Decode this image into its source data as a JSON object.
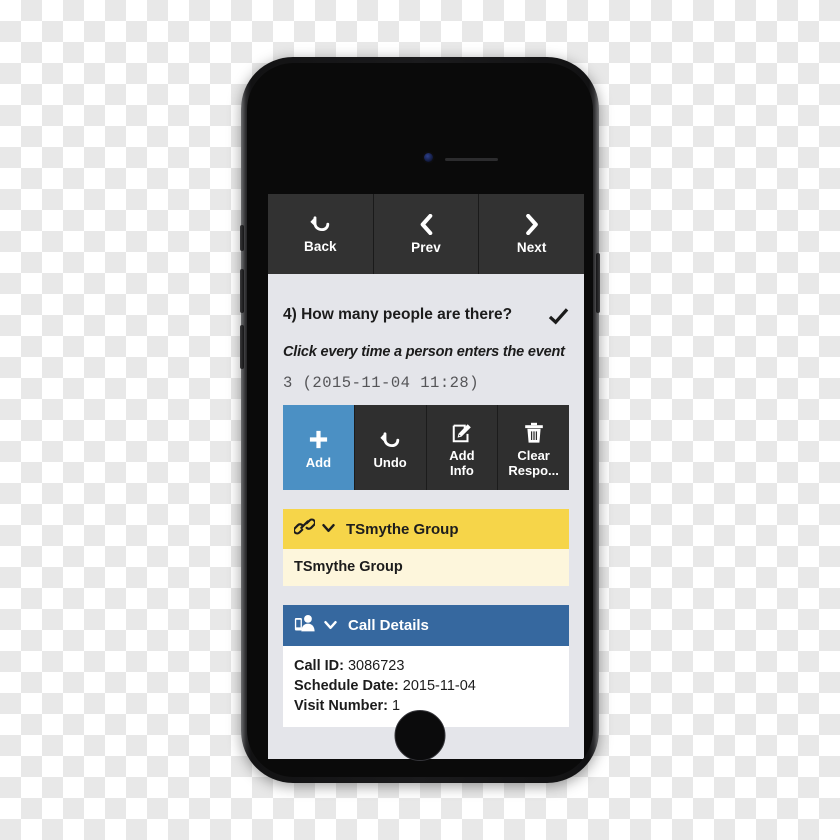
{
  "device": {
    "type": "smartphone",
    "camera": "front-camera",
    "speaker": "earpiece-speaker",
    "home_button": "home-button"
  },
  "navbar": {
    "buttons": [
      {
        "label": "Back",
        "icon": "undo-arrow-icon"
      },
      {
        "label": "Prev",
        "icon": "chevron-left-icon"
      },
      {
        "label": "Next",
        "icon": "chevron-right-icon"
      }
    ]
  },
  "question": {
    "text": "4) How many people are there?",
    "check_icon": "checkmark-icon",
    "hint": "Click every time a person enters the event",
    "response_value": "3 (2015-11-04 11:28)"
  },
  "actions": [
    {
      "label": "Add",
      "icon": "plus-icon",
      "style": "primary"
    },
    {
      "label": "Undo",
      "icon": "undo-arrow-icon",
      "style": "default"
    },
    {
      "label": "Add\nInfo",
      "line1": "Add",
      "line2": "Info",
      "icon": "note-pencil-icon",
      "style": "default"
    },
    {
      "label": "Clear\nRespo...",
      "line1": "Clear",
      "line2": "Respo...",
      "icon": "trash-icon",
      "style": "default"
    }
  ],
  "panels": [
    {
      "id": "tsmythe-group",
      "title": "TSmythe Group",
      "icon": "link-chain-icon",
      "chevron": "chevron-down-icon",
      "header_color": "#f6d549",
      "body_color": "#fdf6dc",
      "body_text": "TSmythe Group"
    },
    {
      "id": "call-details",
      "title": "Call Details",
      "icon": "phone-contact-icon",
      "chevron": "chevron-down-icon",
      "header_color": "#36689f",
      "body_color": "#ffffff",
      "rows": [
        {
          "key": "Call ID:",
          "value": "3086723"
        },
        {
          "key": "Schedule Date:",
          "value": "2015-11-04"
        },
        {
          "key": "Visit Number:",
          "value": "1"
        }
      ]
    }
  ],
  "colors": {
    "navbar_bg": "#323232",
    "screen_bg": "#e4e5ea",
    "accent_blue": "#4b90c4",
    "panel_blue": "#36689f",
    "panel_yellow": "#f6d549",
    "panel_cream": "#fdf6dc",
    "action_dark": "#2f2f2f"
  }
}
